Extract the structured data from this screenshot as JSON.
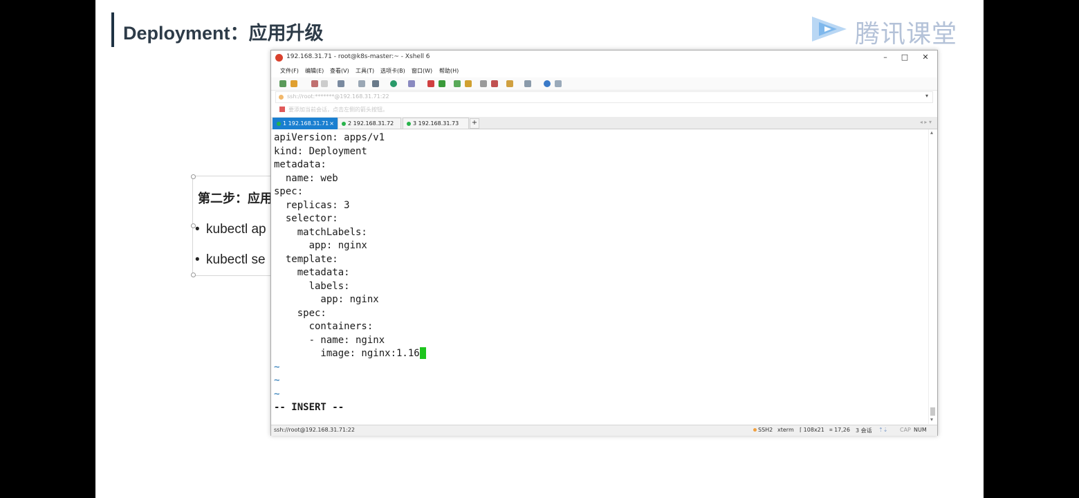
{
  "slide": {
    "title": "Deployment：应用升级",
    "textbox": {
      "heading": "第二步：应用",
      "bullets": [
        "kubectl ap",
        "kubectl se"
      ]
    }
  },
  "logo": {
    "text": "腾讯课堂"
  },
  "window": {
    "title": "192.168.31.71 - root@k8s-master:~ - Xshell 6",
    "controls": {
      "minimize": "–",
      "maximize": "□",
      "close": "✕"
    },
    "menu": [
      "文件(F)",
      "编辑(E)",
      "查看(V)",
      "工具(T)",
      "选项卡(B)",
      "窗口(W)",
      "帮助(H)"
    ],
    "address": "ssh://root:*******@192.168.31.71:22",
    "hint": "要添加当前会话，点击左侧的箭头按钮。",
    "tabs": [
      {
        "label": "1 192.168.31.71",
        "active": true
      },
      {
        "label": "2 192.168.31.72",
        "active": false
      },
      {
        "label": "3 192.168.31.73",
        "active": false
      }
    ],
    "tab_add": "+",
    "terminal_lines": [
      "apiVersion: apps/v1",
      "kind: Deployment",
      "metadata:",
      "  name: web",
      "spec:",
      "  replicas: 3",
      "  selector:",
      "    matchLabels:",
      "      app: nginx",
      "  template:",
      "    metadata:",
      "      labels:",
      "        app: nginx",
      "    spec:",
      "      containers:",
      "      - name: nginx",
      "        image: nginx:1.16",
      "~",
      "~",
      "~",
      "-- INSERT --"
    ],
    "status": {
      "connection": "ssh://root@192.168.31.71:22",
      "protocol": "SSH2",
      "term": "xterm",
      "size": "108x21",
      "cursor_pos": "17,26",
      "sessions": "3 会话",
      "cap": "CAP",
      "num": "NUM"
    }
  },
  "colors": {
    "cursor": "#1ec51e",
    "active_tab": "#1a7fd0",
    "title_bar": "#1f3344"
  }
}
